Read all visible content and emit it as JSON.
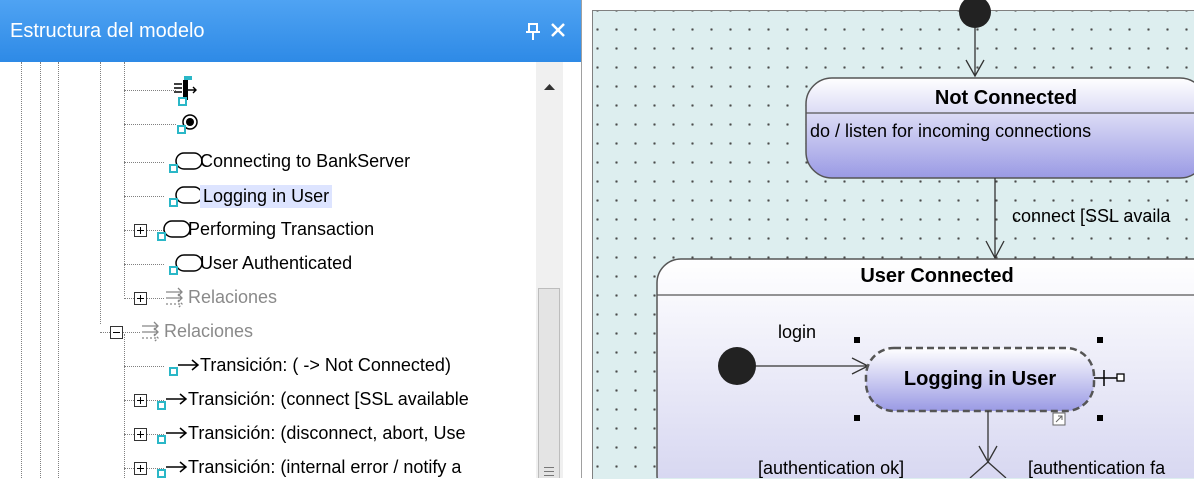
{
  "panel": {
    "title": "Estructura del modelo",
    "pin_icon": "pin-icon",
    "close_icon": "close-icon"
  },
  "tree": {
    "items": [
      {
        "label": "Connecting to BankServer",
        "icon": "state-icon"
      },
      {
        "label": "Logging in User",
        "icon": "state-icon",
        "selected": true
      },
      {
        "label": "Performing Transaction",
        "icon": "state-icon",
        "expander": "plus"
      },
      {
        "label": "User Authenticated",
        "icon": "state-icon"
      },
      {
        "label": "Relaciones",
        "icon": "relations-icon",
        "expander": "plus"
      },
      {
        "label": "Relaciones",
        "icon": "relations-icon",
        "expander": "minus"
      },
      {
        "label": "Transición:  ( -> Not Connected)",
        "icon": "transition-icon"
      },
      {
        "label": "Transición:  (connect [SSL available",
        "icon": "transition-icon",
        "expander": "plus"
      },
      {
        "label": "Transición:  (disconnect, abort, Use",
        "icon": "transition-icon",
        "expander": "plus"
      },
      {
        "label": "Transición:  (internal error / notify a",
        "icon": "transition-icon",
        "expander": "plus"
      }
    ]
  },
  "diagram": {
    "not_connected": {
      "title": "Not Connected",
      "activity": "do / listen for incoming connections"
    },
    "user_connected": {
      "title": "User Connected"
    },
    "logging_in": {
      "title": "Logging in User"
    },
    "transitions": {
      "connect": "connect [SSL availa",
      "login": "login",
      "auth_ok": "[authentication ok]",
      "auth_fail": "[authentication fa"
    },
    "colors": {
      "canvas": "#ddeeef",
      "state_fill_top": "#ffffff",
      "state_fill_bottom": "#9a9ae4",
      "header": "#2e8ae6"
    }
  }
}
